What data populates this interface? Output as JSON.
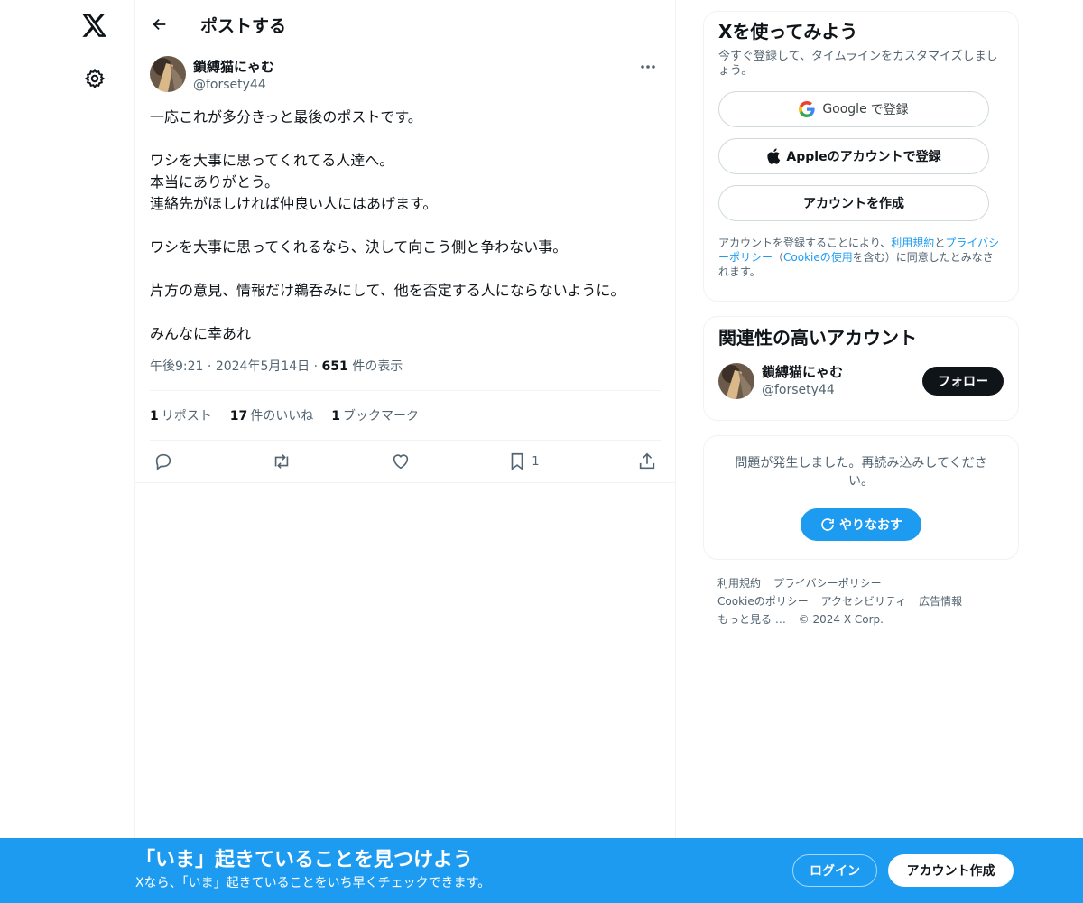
{
  "colors": {
    "accent": "#1d9bf0",
    "text_primary": "#0f1419",
    "text_secondary": "#536471",
    "border": "#eff3f4"
  },
  "nav": {
    "logo_icon": "x-logo-icon",
    "settings_icon": "gear-icon"
  },
  "header": {
    "title": "ポストする",
    "back_icon": "arrow-left-icon"
  },
  "post": {
    "author_name": "鎖縛猫にゃむ",
    "author_handle": "@forsety44",
    "lines": [
      "一応これが多分きっと最後のポストです。",
      "",
      "ワシを大事に思ってくれてる人達へ。",
      "本当にありがとう。",
      "連絡先がほしければ仲良い人にはあげます。",
      "",
      "ワシを大事に思ってくれるなら、決して向こう側と争わない事。",
      "",
      "片方の意見、情報だけ鵜呑みにして、他を否定する人にならないように。",
      "",
      "みんなに幸あれ"
    ],
    "time": "午後9:21",
    "date": "2024年5月14日",
    "views_count": "651",
    "views_label": "件の表示",
    "reposts_count": "1",
    "reposts_label": "リポスト",
    "likes_count": "17",
    "likes_label": "件のいいね",
    "bookmarks_count": "1",
    "bookmarks_label": "ブックマーク",
    "bookmark_action_count": "1"
  },
  "signup_card": {
    "title": "Xを使ってみよう",
    "subtitle": "今すぐ登録して、タイムラインをカスタマイズしましょう。",
    "google_label": "Google",
    "google_suffix": "で登録",
    "apple_label": "Appleのアカウントで登録",
    "create_label": "アカウントを作成",
    "legal_prefix": "アカウントを登録することにより、",
    "legal_terms": "利用規約",
    "legal_and": "と",
    "legal_privacy": "プライバシーポリシー",
    "legal_mid": "（",
    "legal_cookie": "Cookieの使用",
    "legal_suffix": "を含む）に同意したとみなされます。"
  },
  "related_card": {
    "title": "関連性の高いアカウント",
    "name": "鎖縛猫にゃむ",
    "handle": "@forsety44",
    "follow_label": "フォロー"
  },
  "error_card": {
    "message": "問題が発生しました。再読み込みしてください。",
    "retry_label": "やりなおす"
  },
  "footer": {
    "terms": "利用規約",
    "privacy": "プライバシーポリシー",
    "cookie": "Cookieのポリシー",
    "accessibility": "アクセシビリティ",
    "ads": "広告情報",
    "more": "もっと見る …",
    "copyright": "© 2024 X Corp."
  },
  "bottom_bar": {
    "title": "「いま」起きていることを見つけよう",
    "subtitle": "Xなら、「いま」起きていることをいち早くチェックできます。",
    "login_label": "ログイン",
    "signup_label": "アカウント作成"
  }
}
